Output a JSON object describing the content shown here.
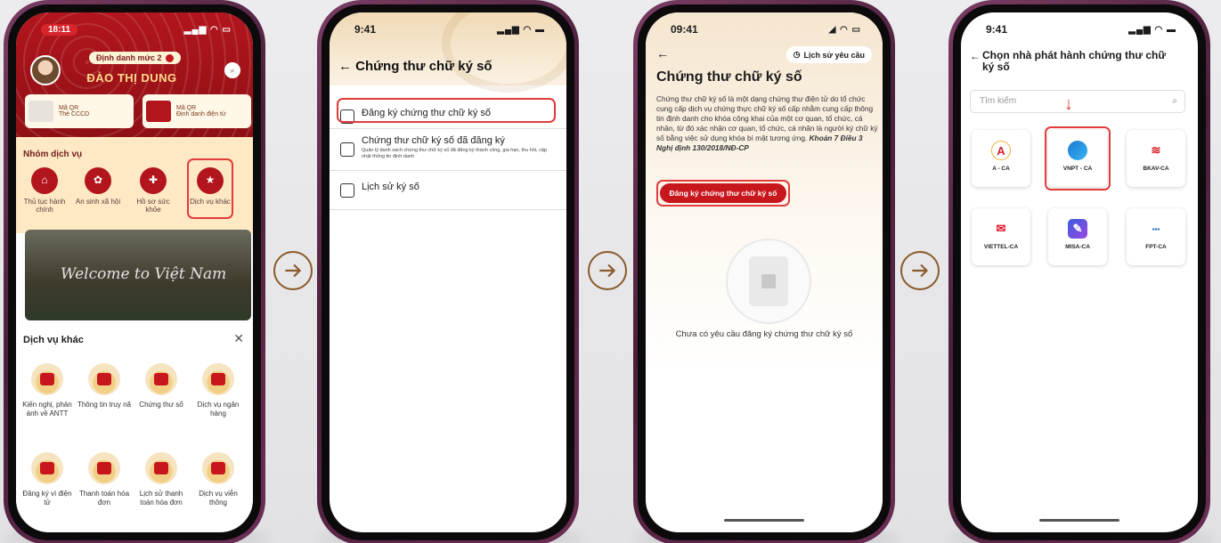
{
  "phone1": {
    "time": "18:11",
    "level_badge": "Định danh mức 2",
    "user_name": "ĐÀO THỊ DUNG",
    "qr_cards": [
      {
        "title": "Mã QR",
        "subtitle": "Thẻ CCCD"
      },
      {
        "title": "Mã QR",
        "subtitle": "Định danh điện tử"
      }
    ],
    "service_group_title": "Nhóm dịch vụ",
    "services": [
      "Thủ tục hành chính",
      "An sinh xã hội",
      "Hồ sơ sức khỏe",
      "Dịch vụ khác"
    ],
    "banner_text": "Welcome to Việt Nam",
    "sheet_title": "Dịch vụ khác",
    "sheet_items": [
      "Kiến nghị, phản ánh về ANTT",
      "Thông tin truy nã",
      "Chứng thư số",
      "Dịch vụ ngân hàng",
      "Đăng ký ví điện tử",
      "Thanh toán hóa đơn",
      "Lịch sử thanh toán hóa đơn",
      "Dịch vụ viễn thông"
    ]
  },
  "phone2": {
    "time": "9:41",
    "title": "Chứng thư chữ ký số",
    "items": [
      {
        "label": "Đăng ký chứng thư chữ ký số",
        "desc": ""
      },
      {
        "label": "Chứng thư chữ ký số đã đăng ký",
        "desc": "Quản lý danh sách chứng thư chữ ký số đã đăng ký thành công, gia hạn, thu hồi, cập nhật thông tin định danh"
      },
      {
        "label": "Lịch sử ký số",
        "desc": ""
      }
    ]
  },
  "phone3": {
    "time": "09:41",
    "history_button": "Lịch sử yêu cầu",
    "title": "Chứng thư chữ ký số",
    "description": "Chứng thư chữ ký số là một dạng chứng thư điện tử do tổ chức cung cấp dịch vụ chứng thực chữ ký số cấp nhằm cung cấp thông tin định danh cho khóa công khai của một cơ quan, tổ chức, cá nhân, từ đó xác nhận cơ quan, tổ chức, cá nhân là người ký chữ ký số bằng việc sử dụng khóa bí mật tương ứng.",
    "legal_ref": "Khoản 7 Điều 3 Nghị định 130/2018/NĐ-CP",
    "register_button": "Đăng ký chứng thư chữ ký số",
    "empty_text": "Chưa có yêu cầu đăng ký chứng thư chữ ký số"
  },
  "phone4": {
    "time": "9:41",
    "title": "Chọn nhà phát hành chứng thư chữ ký số",
    "search_placeholder": "Tìm kiếm",
    "providers": [
      "A - CA",
      "VNPT - CA",
      "BKAV-CA",
      "VIETTEL-CA",
      "MISA-CA",
      "FPT-CA"
    ]
  },
  "colors": {
    "brand_red": "#c8161d",
    "highlight": "#e23b3b",
    "arrow": "#8a5a2b"
  }
}
